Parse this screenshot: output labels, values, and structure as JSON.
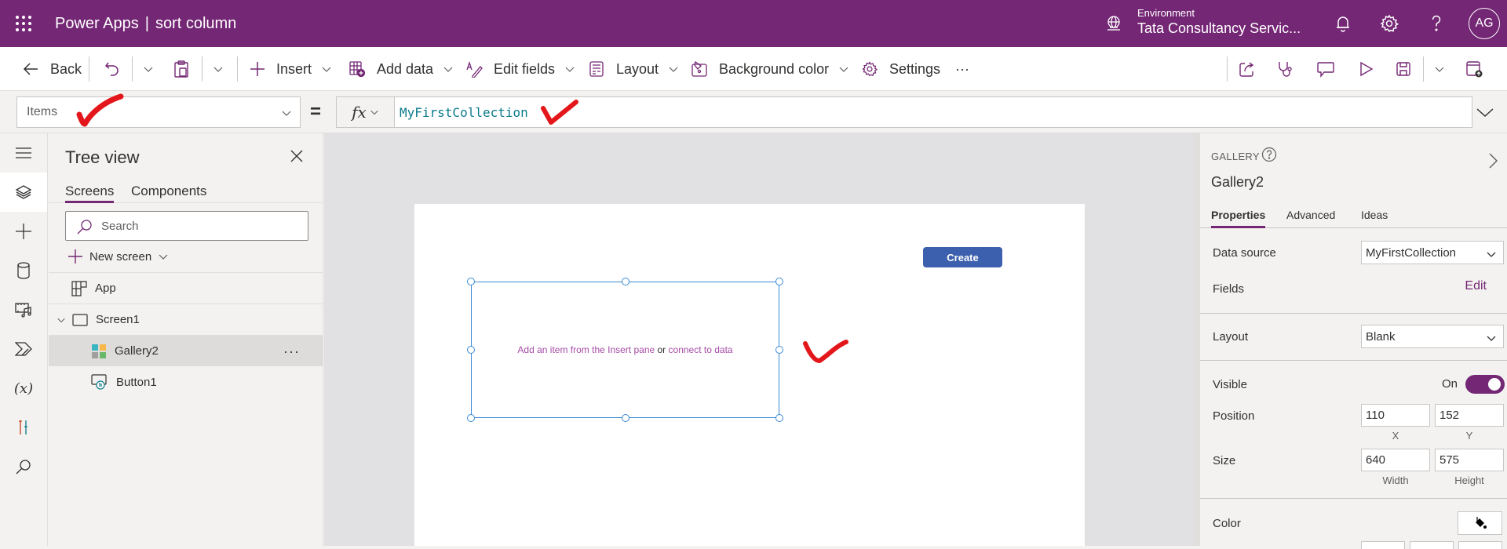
{
  "topbar": {
    "app_name": "Power Apps",
    "separator": "|",
    "app_title": "sort column",
    "environment_label": "Environment",
    "environment_name": "Tata Consultancy Servic...",
    "avatar_initials": "AG",
    "brand_color": "#742774"
  },
  "commandbar": {
    "back": "Back",
    "insert": "Insert",
    "add_data": "Add data",
    "edit_fields": "Edit fields",
    "layout": "Layout",
    "background_color": "Background color",
    "settings": "Settings",
    "more": "···"
  },
  "formulabar": {
    "property": "Items",
    "equals": "=",
    "fx": "fx",
    "formula": "MyFirstCollection"
  },
  "leftrail": {
    "items": [
      "menu-icon",
      "tree-view-icon",
      "insert-icon",
      "data-icon",
      "media-icon",
      "power-automate-icon",
      "variables-icon",
      "advanced-tools-icon",
      "search-icon"
    ]
  },
  "treeview": {
    "title": "Tree view",
    "tabs": [
      "Screens",
      "Components"
    ],
    "search_placeholder": "Search",
    "new_screen": "New screen",
    "items": [
      {
        "label": "App",
        "level": 0
      },
      {
        "label": "Screen1",
        "level": 0,
        "expanded": true
      },
      {
        "label": "Gallery2",
        "level": 1,
        "selected": true
      },
      {
        "label": "Button1",
        "level": 1
      }
    ],
    "more": "···"
  },
  "canvas": {
    "create_button": "Create",
    "gallery_msg_part1": "Add an item from the Insert pane",
    "gallery_msg_or": " or ",
    "gallery_msg_part2": "connect to data"
  },
  "properties": {
    "control_type": "GALLERY",
    "control_name": "Gallery2",
    "tabs": [
      "Properties",
      "Advanced",
      "Ideas"
    ],
    "data_source_label": "Data source",
    "data_source_value": "MyFirstCollection",
    "fields_label": "Fields",
    "fields_edit": "Edit",
    "layout_label": "Layout",
    "layout_value": "Blank",
    "visible_label": "Visible",
    "visible_state": "On",
    "position_label": "Position",
    "position_x": "110",
    "position_y": "152",
    "x_caption": "X",
    "y_caption": "Y",
    "size_label": "Size",
    "width": "640",
    "height": "575",
    "width_caption": "Width",
    "height_caption": "Height",
    "color_label": "Color"
  }
}
